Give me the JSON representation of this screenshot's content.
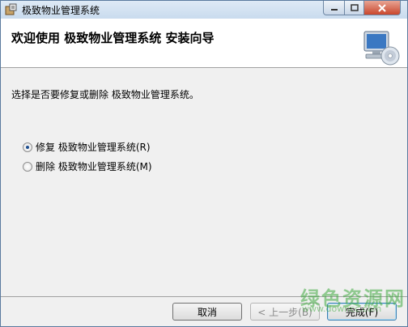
{
  "window": {
    "title": "极致物业管理系统"
  },
  "header": {
    "title": "欢迎使用 极致物业管理系统 安装向导"
  },
  "body": {
    "instruction": "选择是否要修复或删除 极致物业管理系统。",
    "options": [
      {
        "label": "修复 极致物业管理系统(R)",
        "checked": true
      },
      {
        "label": "删除 极致物业管理系统(M)",
        "checked": false
      }
    ]
  },
  "footer": {
    "cancel_label": "取消",
    "back_label": "< 上一步(B)",
    "finish_label": "完成(F)"
  },
  "watermark": {
    "text": "绿色资源网",
    "sub": "www.downcc.com"
  },
  "colors": {
    "accent": "#3c7fb1",
    "close_button": "#c9472d",
    "watermark": "#40aa40"
  }
}
